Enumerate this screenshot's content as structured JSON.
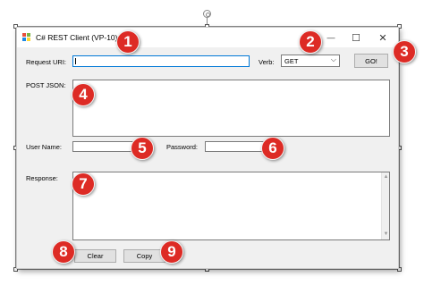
{
  "window": {
    "title": "C# REST Client (VP-10)",
    "minimize_glyph": "—",
    "maximize_glyph": "☐",
    "close_glyph": "✕"
  },
  "form": {
    "request_uri_label": "Request URI:",
    "request_uri_value": "",
    "verb_label": "Verb:",
    "verb_value": "GET",
    "verb_dropdown_glyph": "⌵",
    "go_label": "GO!",
    "post_json_label": "POST JSON:",
    "post_json_value": "",
    "username_label": "User Name:",
    "username_value": "",
    "password_label": "Password:",
    "password_value": "",
    "response_label": "Response:",
    "response_value": "",
    "clear_label": "Clear",
    "copy_label": "Copy",
    "scroll_up_glyph": "▲",
    "scroll_down_glyph": "▼"
  },
  "markers": [
    "1",
    "2",
    "3",
    "4",
    "5",
    "6",
    "7",
    "8",
    "9"
  ],
  "colors": {
    "marker": "#dd2b25",
    "focus_border": "#0078d7",
    "window_bg": "#f0f0f0"
  }
}
